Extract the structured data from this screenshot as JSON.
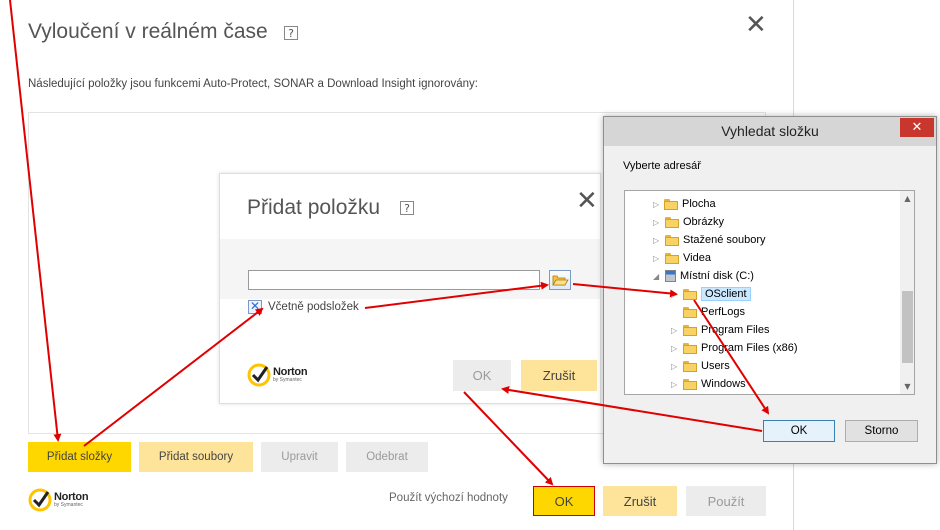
{
  "main": {
    "title": "Vyloučení v reálném čase",
    "help": "?",
    "description": "Následující položky jsou funkcemi Auto-Protect, SONAR a Download Insight ignorovány:",
    "buttons": {
      "add_folders": "Přidat složky",
      "add_files": "Přidat soubory",
      "edit": "Upravit",
      "remove": "Odebrat"
    },
    "footer": {
      "defaults_link": "Použít výchozí hodnoty",
      "ok": "OK",
      "cancel": "Zrušit",
      "apply": "Použít"
    },
    "logo": {
      "brand": "Norton",
      "sub": "by Symantec"
    }
  },
  "add_item": {
    "title": "Přidat položku",
    "help": "?",
    "path_value": "",
    "include_subfolders_label": "Včetně podsložek",
    "include_subfolders_checked": true,
    "ok": "OK",
    "cancel": "Zrušit",
    "logo": {
      "brand": "Norton",
      "sub": "by Symantec"
    }
  },
  "browse": {
    "title": "Vyhledat složku",
    "close": "✕",
    "prompt": "Vyberte adresář",
    "tree": [
      {
        "label": "Plocha",
        "icon": "desktop-folder-icon"
      },
      {
        "label": "Obrázky",
        "icon": "pictures-folder-icon"
      },
      {
        "label": "Stažené soubory",
        "icon": "downloads-folder-icon"
      },
      {
        "label": "Videa",
        "icon": "videos-folder-icon"
      },
      {
        "label": "Místní disk (C:)",
        "icon": "local-disk-icon"
      },
      {
        "label": "OSclient",
        "icon": "folder-icon",
        "selected": true
      },
      {
        "label": "PerfLogs",
        "icon": "folder-icon"
      },
      {
        "label": "Program Files",
        "icon": "folder-icon"
      },
      {
        "label": "Program Files (x86)",
        "icon": "folder-icon"
      },
      {
        "label": "Users",
        "icon": "folder-icon"
      },
      {
        "label": "Windows",
        "icon": "folder-icon"
      }
    ],
    "ok": "OK",
    "cancel": "Storno"
  },
  "colors": {
    "accent_yellow": "#ffd700",
    "light_yellow": "#fde49a",
    "arrow_red": "#e00000",
    "close_red": "#c7372e"
  }
}
